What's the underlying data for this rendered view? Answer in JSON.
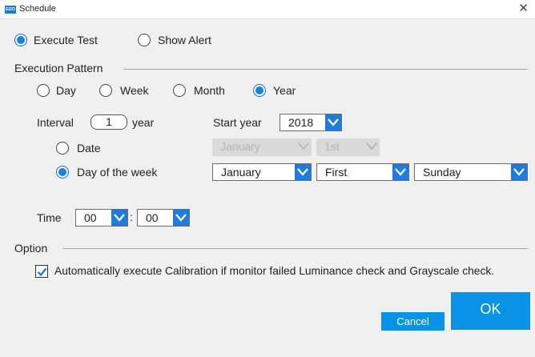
{
  "window": {
    "title": "Schedule",
    "app_icon_text": "EIZO"
  },
  "mode": {
    "execute_test": "Execute Test",
    "show_alert": "Show Alert",
    "selected": "execute_test"
  },
  "pattern": {
    "heading": "Execution Pattern",
    "day": "Day",
    "week": "Week",
    "month": "Month",
    "year": "Year",
    "selected": "year"
  },
  "interval": {
    "label": "Interval",
    "value": "1",
    "unit": "year"
  },
  "start_year": {
    "label": "Start year",
    "value": "2018"
  },
  "date_option": {
    "label": "Date",
    "month": "January",
    "day": "1st"
  },
  "dow_option": {
    "label": "Day of the week",
    "month": "January",
    "ordinal": "First",
    "weekday": "Sunday"
  },
  "time": {
    "label": "Time",
    "hour": "00",
    "separator": ":",
    "minute": "00"
  },
  "option": {
    "heading": "Option",
    "auto_calibration": "Automatically execute Calibration if monitor failed Luminance check and Grayscale check.",
    "checked": true
  },
  "buttons": {
    "cancel": "Cancel",
    "ok": "OK"
  },
  "colors": {
    "accent": "#1e7be0",
    "button": "#0a93e6"
  }
}
